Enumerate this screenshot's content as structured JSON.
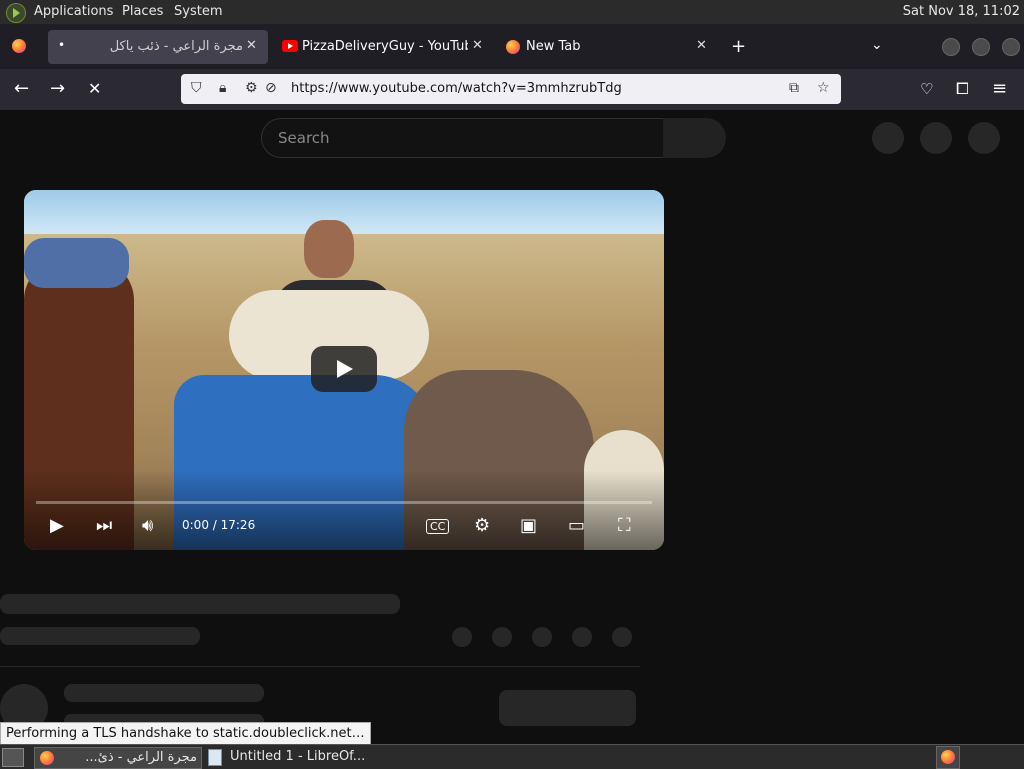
{
  "top_panel": {
    "applications": "Applications",
    "places": "Places",
    "system": "System",
    "clock": "Sat Nov 18, 11:02"
  },
  "tabs": [
    {
      "label": "مجرة الراعي - ذئب ياكل",
      "icon": "firefox-icon",
      "active": true
    },
    {
      "label": "PizzaDeliveryGuy - YouTube",
      "icon": "youtube-icon",
      "active": false
    },
    {
      "label": "New Tab",
      "icon": "firefox-icon",
      "active": false
    }
  ],
  "navbar": {
    "url": "https://www.youtube.com/watch?v=3mmhzrubTdg"
  },
  "youtube": {
    "search_placeholder": "Search",
    "player": {
      "time": "0:00 / 17:26",
      "progress": 0
    }
  },
  "status_tip": "Performing a TLS handshake to static.doubleclick.net…",
  "taskbar": {
    "items": [
      {
        "label": "مجرة الراعي - ذئ...",
        "icon": "firefox-icon"
      },
      {
        "label": "Untitled 1 - LibreOf...",
        "icon": "document-icon"
      }
    ]
  },
  "colors": {
    "youtube_bg": "#0f0f0f",
    "firefox_tabbar": "#1f1e25",
    "firefox_navbar": "#2b2a33"
  }
}
